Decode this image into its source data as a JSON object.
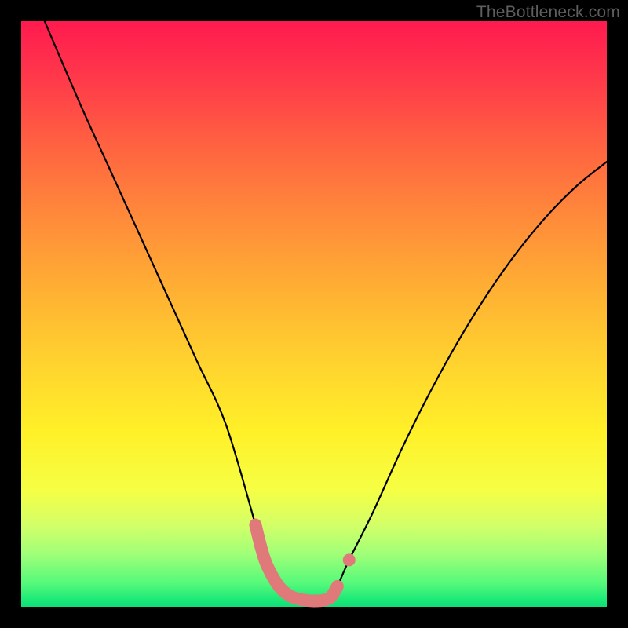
{
  "watermark": "TheBottleneck.com",
  "chart_data": {
    "type": "line",
    "title": "",
    "xlabel": "",
    "ylabel": "",
    "xlim": [
      0,
      100
    ],
    "ylim": [
      0,
      100
    ],
    "series": [
      {
        "name": "black-curve",
        "color": "#000000",
        "x": [
          4,
          10,
          15,
          20,
          25,
          30,
          35,
          40,
          41,
          42,
          44,
          46,
          48,
          50,
          52,
          53,
          54,
          56,
          60,
          65,
          70,
          75,
          80,
          85,
          90,
          95,
          100
        ],
        "values": [
          100,
          86,
          75,
          64,
          53,
          42,
          31,
          14,
          10,
          7,
          3.5,
          1.8,
          1.2,
          1.0,
          1.2,
          1.8,
          3.5,
          8,
          16,
          27,
          37,
          46,
          54,
          61,
          67,
          72,
          76
        ]
      },
      {
        "name": "pink-trough-overlay",
        "color": "#e07a7a",
        "x": [
          40,
          41,
          42,
          44,
          46,
          48,
          50,
          52,
          53,
          54
        ],
        "values": [
          14,
          10,
          7,
          3.5,
          1.8,
          1.2,
          1.0,
          1.2,
          1.8,
          3.5
        ]
      }
    ]
  }
}
